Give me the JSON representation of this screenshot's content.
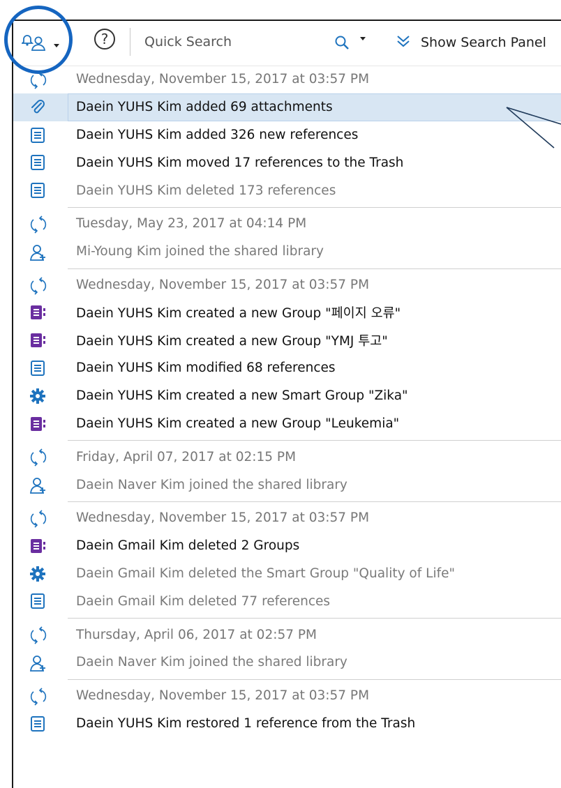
{
  "toolbar": {
    "activity_icon": "person-bell-icon",
    "help_label": "?",
    "search_placeholder": "Quick Search",
    "search_icon": "search-icon",
    "show_search_panel_label": "Show Search Panel"
  },
  "colors": {
    "accent": "#1565c0",
    "doc": "#1e73be",
    "group": "#6a2ea0",
    "selected_bg": "#d8e6f3"
  },
  "groups": [
    {
      "date": "Wednesday, November 15, 2017 at 03:57 PM",
      "items": [
        {
          "icon": "paperclip-icon",
          "text": "Daein YUHS Kim added 69 attachments",
          "muted": false,
          "selected": true
        },
        {
          "icon": "document-icon",
          "text": "Daein YUHS Kim added 326 new references",
          "muted": false
        },
        {
          "icon": "document-icon",
          "text": "Daein YUHS Kim moved 17 references to the Trash",
          "muted": false
        },
        {
          "icon": "document-icon",
          "text": "Daein YUHS Kim deleted 173 references",
          "muted": true
        }
      ]
    },
    {
      "date": "Tuesday, May 23, 2017 at 04:14 PM",
      "items": [
        {
          "icon": "user-add-icon",
          "text": "Mi-Young Kim joined the shared library",
          "muted": true
        }
      ]
    },
    {
      "date": "Wednesday, November 15, 2017 at 03:57 PM",
      "items": [
        {
          "icon": "group-icon",
          "text": "Daein YUHS Kim created a new Group \"페이지 오류\"",
          "muted": false
        },
        {
          "icon": "group-icon",
          "text": "Daein YUHS Kim created a new Group \"YMJ 투고\"",
          "muted": false
        },
        {
          "icon": "document-icon",
          "text": "Daein YUHS Kim modified 68 references",
          "muted": false
        },
        {
          "icon": "gear-icon",
          "text": "Daein YUHS Kim created a new Smart Group \"Zika\"",
          "muted": false
        },
        {
          "icon": "group-icon",
          "text": "Daein YUHS Kim created a new Group \"Leukemia\"",
          "muted": false
        }
      ]
    },
    {
      "date": "Friday, April 07, 2017 at 02:15 PM",
      "items": [
        {
          "icon": "user-add-icon",
          "text": "Daein Naver Kim joined the shared library",
          "muted": true
        }
      ]
    },
    {
      "date": "Wednesday, November 15, 2017 at 03:57 PM",
      "items": [
        {
          "icon": "group-icon",
          "text": "Daein Gmail Kim deleted 2 Groups",
          "muted": false
        },
        {
          "icon": "gear-icon",
          "text": "Daein Gmail Kim deleted the Smart Group \"Quality of Life\"",
          "muted": true
        },
        {
          "icon": "document-icon",
          "text": "Daein Gmail Kim deleted 77 references",
          "muted": true
        }
      ]
    },
    {
      "date": "Thursday, April 06, 2017 at 02:57 PM",
      "items": [
        {
          "icon": "user-add-icon",
          "text": "Daein Naver Kim joined the shared library",
          "muted": true
        }
      ]
    },
    {
      "date": "Wednesday, November 15, 2017 at 03:57 PM",
      "items": [
        {
          "icon": "document-icon",
          "text": "Daein YUHS Kim restored 1 reference from the Trash",
          "muted": false
        }
      ]
    }
  ]
}
